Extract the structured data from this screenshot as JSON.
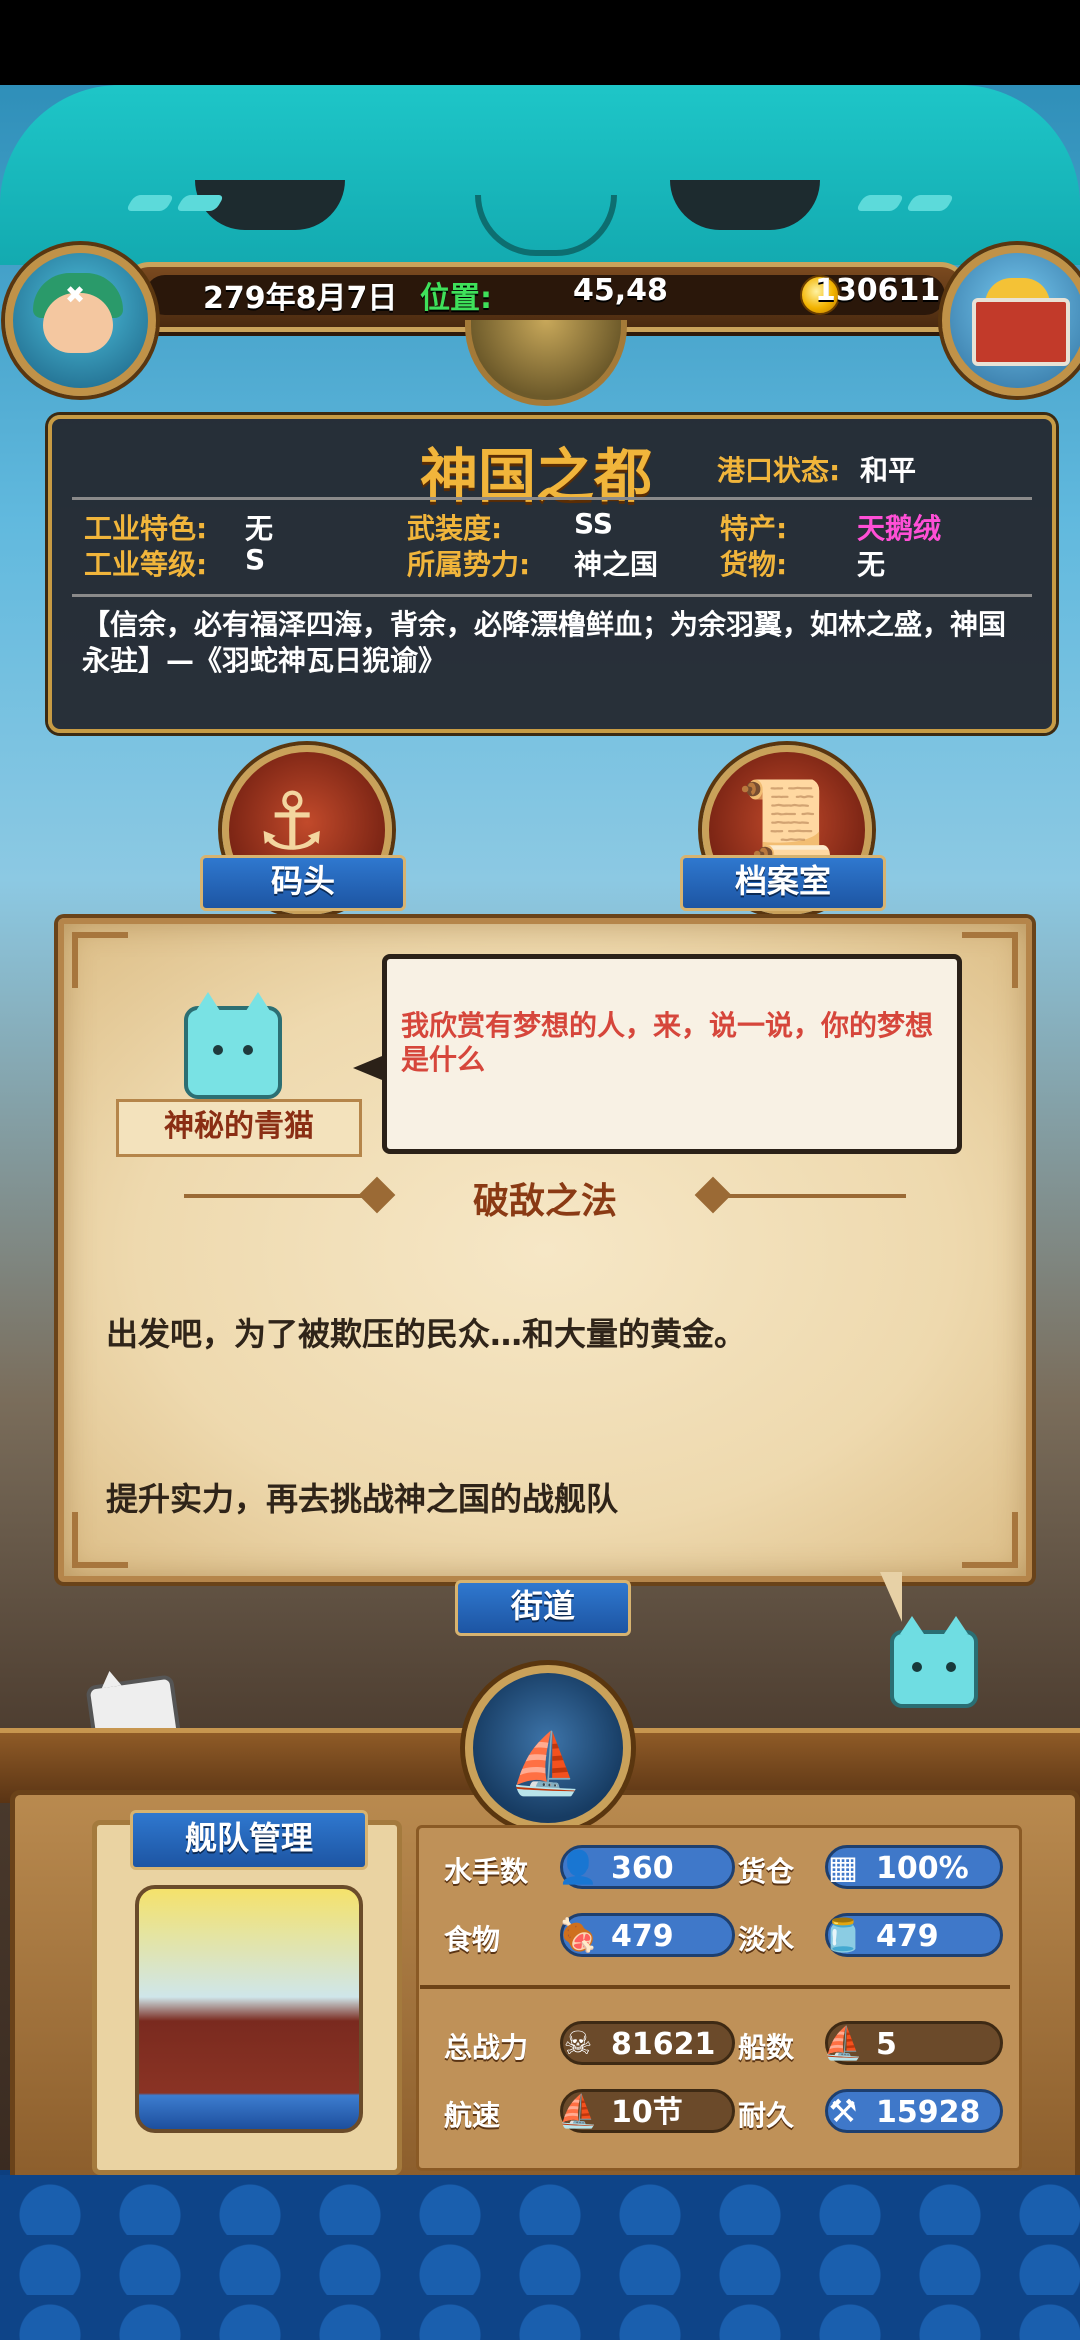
{
  "hud": {
    "date": "279年8月7日",
    "position_label": "位置:",
    "position_value": "45,48",
    "gold": "130611"
  },
  "port": {
    "name": "神国之都",
    "status_label": "港口状态:",
    "status_value": "和平",
    "fields": {
      "industry_feature_label": "工业特色:",
      "industry_feature_value": "无",
      "armament_label": "武装度:",
      "armament_value": "SS",
      "specialty_label": "特产:",
      "specialty_value": "天鹅绒",
      "industry_level_label": "工业等级:",
      "industry_level_value": "S",
      "faction_label": "所属势力:",
      "faction_value": "神之国",
      "goods_label": "货物:",
      "goods_value": "无"
    },
    "quote": "【信余，必有福泽四海，背余，必降漂橹鲜血；为余羽翼，如林之盛，神国永驻】—《羽蛇神瓦日猊谕》"
  },
  "buttons": {
    "dock": "码头",
    "archive": "档案室",
    "street": "街道",
    "fleet_manage": "舰队管理"
  },
  "dialog": {
    "npc_name": "神秘的青猫",
    "speech": "我欣赏有梦想的人，来，说一说，你的梦想是什么",
    "title": "破敌之法",
    "line1": "出发吧，为了被欺压的民众…和大量的黄金。",
    "line2": "提升实力，再去挑战神之国的战舰队"
  },
  "fleet": {
    "sailors_label": "水手数",
    "sailors": "360",
    "cargo_label": "货仓",
    "cargo": "100%",
    "food_label": "食物",
    "food": "479",
    "water_label": "淡水",
    "water": "479",
    "power_label": "总战力",
    "power": "81621",
    "ships_label": "船数",
    "ships": "5",
    "speed_label": "航速",
    "speed": "10节",
    "durability_label": "耐久",
    "durability": "15928"
  },
  "colors": {
    "gold_text": "#f1b53b",
    "pink_specialty": "#ff4fd6",
    "speech_red": "#d6463b",
    "ribbon_blue": "#2f78cf"
  }
}
